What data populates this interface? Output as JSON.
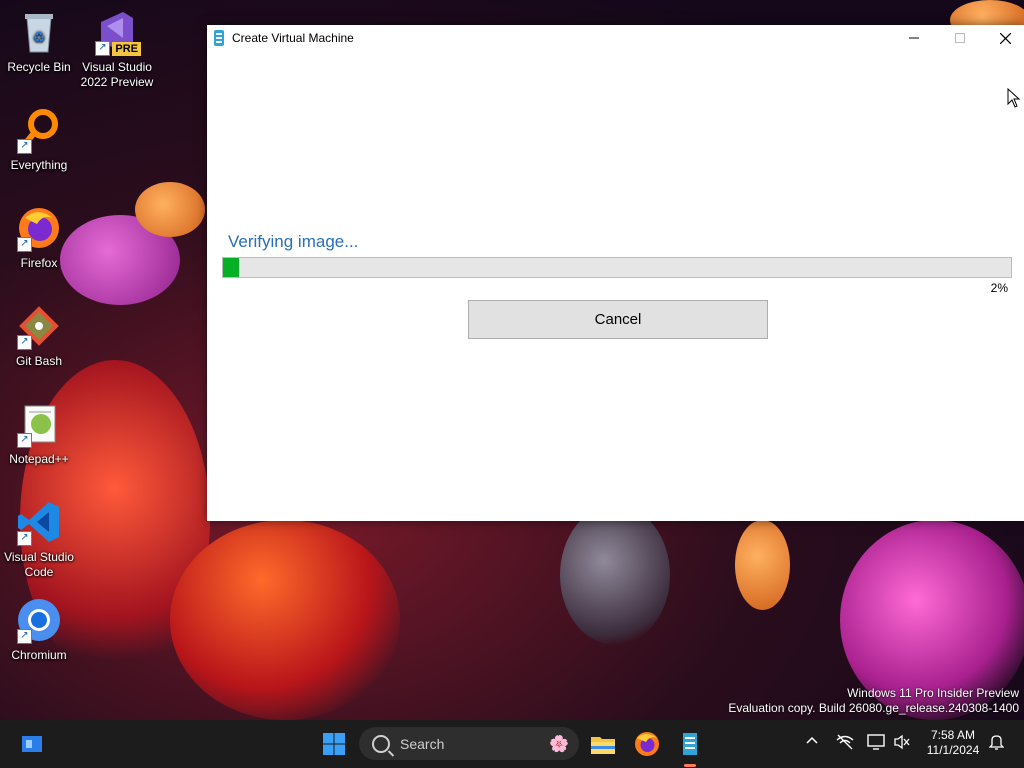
{
  "desktop": {
    "icons": [
      {
        "label": "Recycle Bin"
      },
      {
        "label": "Visual Studio 2022 Preview",
        "badge": "PRE"
      },
      {
        "label": "Everything"
      },
      {
        "label": "Firefox"
      },
      {
        "label": "Git Bash"
      },
      {
        "label": "Notepad++"
      },
      {
        "label": "Visual Studio Code"
      },
      {
        "label": "Chromium"
      }
    ],
    "watermark_line1": "Windows 11 Pro Insider Preview",
    "watermark_line2": "Evaluation copy. Build 26080.ge_release.240308-1400"
  },
  "window": {
    "title": "Create Virtual Machine",
    "status": "Verifying image...",
    "progress_percent": 2,
    "progress_label": "2%",
    "cancel_label": "Cancel"
  },
  "taskbar": {
    "search_placeholder": "Search",
    "time": "7:58 AM",
    "date": "11/1/2024"
  },
  "colors": {
    "progress_fill": "#06b025",
    "status_text": "#2a6fb8",
    "taskbar_bg": "#1c1c1c"
  }
}
